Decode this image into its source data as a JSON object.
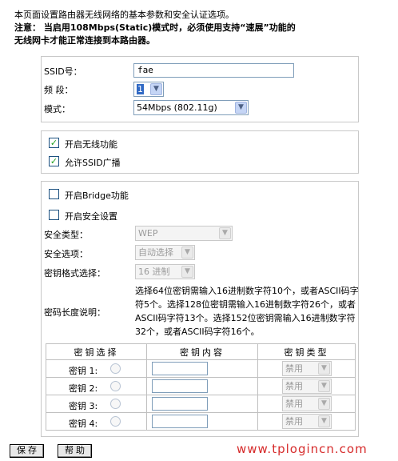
{
  "intro": "本页面设置路由器无线网络的基本参数和安全认证选项。",
  "note_line1": "注意： 当启用108Mbps(Static)模式时，必须使用支持“速展”功能的",
  "note_line2": "无线网卡才能正常连接到本路由器。",
  "basic": {
    "ssid_label": "SSID号：",
    "ssid_value": "fae",
    "channel_label": "频 段：",
    "channel_value": "1",
    "mode_label": "模式：",
    "mode_value": "54Mbps (802.11g)"
  },
  "wireless": {
    "enable_label": "开启无线功能",
    "enable_checked": true,
    "broadcast_label": "允许SSID广播",
    "broadcast_checked": true
  },
  "security": {
    "bridge_label": "开启Bridge功能",
    "bridge_checked": false,
    "security_label": "开启安全设置",
    "security_checked": false,
    "type_label": "安全类型：",
    "type_value": "WEP",
    "option_label": "安全选项：",
    "option_value": "自动选择",
    "format_label": "密钥格式选择：",
    "format_value": "16 进制",
    "length_label": "密码长度说明：",
    "length_desc": "选择64位密钥需输入16进制数字符10个，或者ASCII码字符5个。选择128位密钥需输入16进制数字符26个，或者ASCII码字符13个。选择152位密钥需输入16进制数字符32个，或者ASCII码字符16个。"
  },
  "key_table": {
    "headers": [
      "密钥选择",
      "密钥内容",
      "密钥类型"
    ],
    "rows": [
      {
        "label": "密钥 1:",
        "type": "禁用"
      },
      {
        "label": "密钥 2:",
        "type": "禁用"
      },
      {
        "label": "密钥 3:",
        "type": "禁用"
      },
      {
        "label": "密钥 4:",
        "type": "禁用"
      }
    ]
  },
  "buttons": {
    "save": "保存",
    "help": "帮助"
  },
  "watermark": "www.tplogincn.com"
}
